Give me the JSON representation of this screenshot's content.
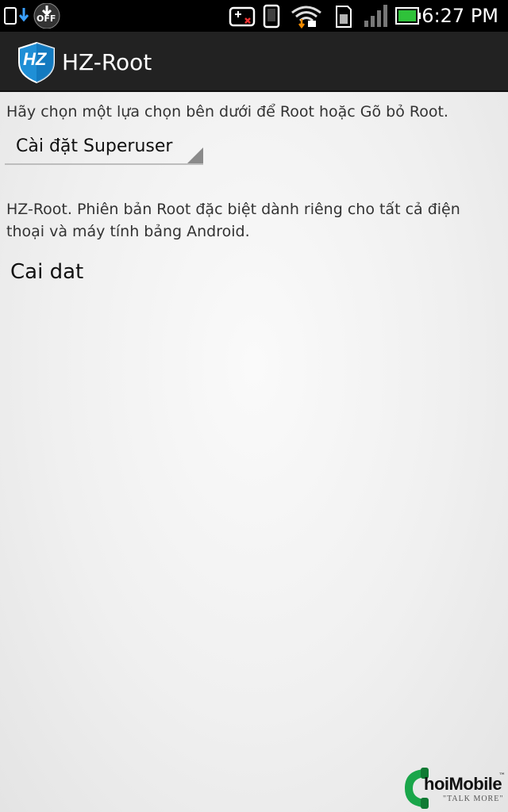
{
  "status_bar": {
    "time": "6:27 PM",
    "off_badge": "OFF",
    "icons": [
      "screenshot-download-icon",
      "download-off-icon",
      "gamepad-icon",
      "phone-icon",
      "wifi-icon",
      "sdcard-icon",
      "signal-icon",
      "battery-icon"
    ]
  },
  "action_bar": {
    "logo_text": "HZ",
    "title": "HZ-Root"
  },
  "main": {
    "instruction": "Hãy chọn một lựa chọn bên dưới để Root hoặc Gõ bỏ Root.",
    "spinner_selected": "Cài đặt Superuser",
    "description": "HZ-Root. Phiên bản Root đặc biệt dành riêng cho tất cả điện thoại và máy tính bảng Android.",
    "action_text": "Cai dat"
  },
  "watermark": {
    "letter": "C",
    "brand": "hoiMobile",
    "tm": "™",
    "tagline": "\"TALK MORE\""
  },
  "colors": {
    "status_bar_bg": "#000000",
    "action_bar_bg": "#222222",
    "logo_blue": "#1f8fd6",
    "watermark_green": "#1aa64a"
  }
}
